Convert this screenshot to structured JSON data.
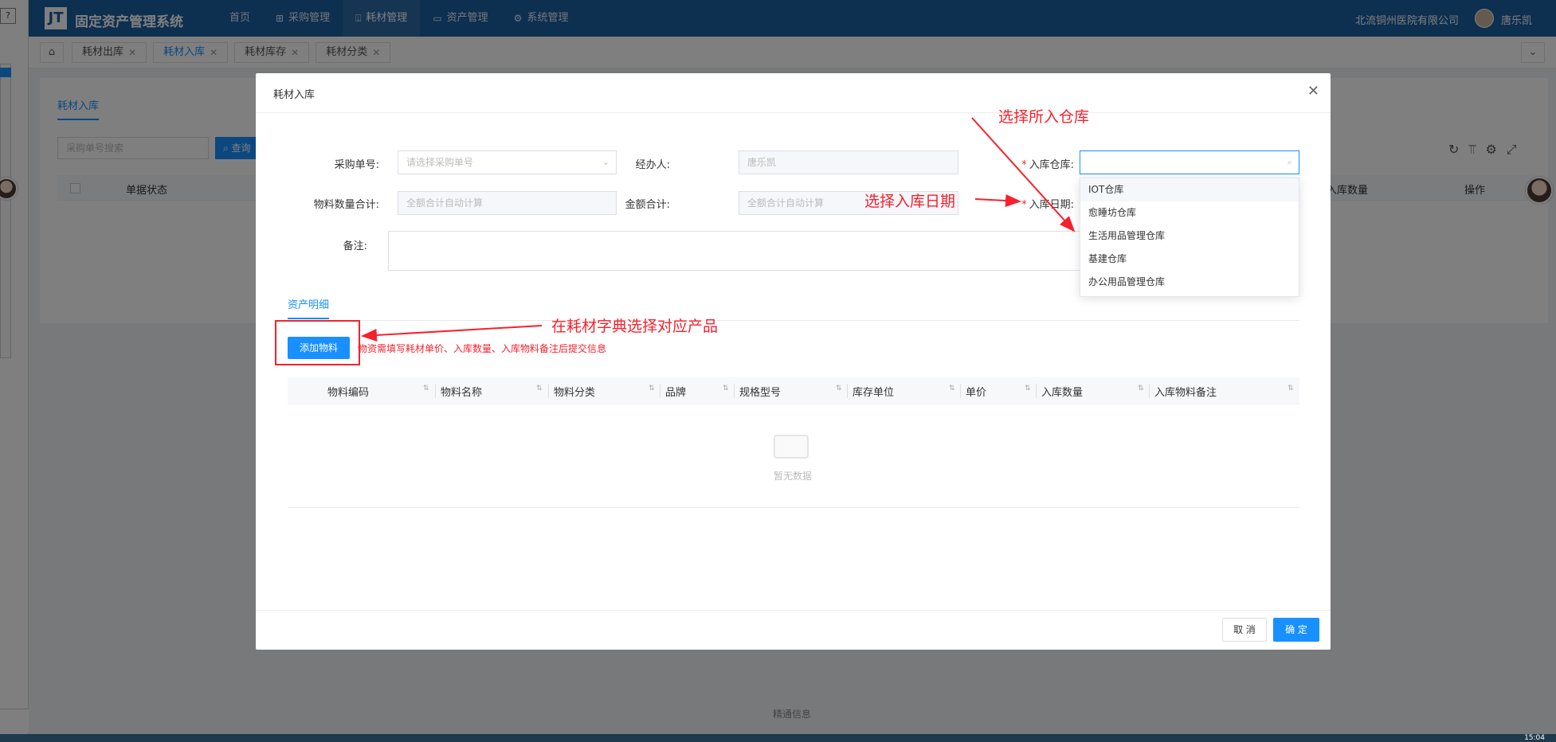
{
  "app": {
    "logo_text": "JT",
    "title": "固定资产管理系统",
    "nav": [
      {
        "label": "首页",
        "icon": ""
      },
      {
        "label": "采购管理",
        "icon": "grid-icon"
      },
      {
        "label": "耗材管理",
        "icon": "inbox-icon"
      },
      {
        "label": "资产管理",
        "icon": "calendar-icon"
      },
      {
        "label": "系统管理",
        "icon": "gear-icon"
      }
    ],
    "organization": "北流铜州医院有限公司",
    "user_name": "唐乐凯"
  },
  "tabs": [
    {
      "label": "耗材出库"
    },
    {
      "label": "耗材入库"
    },
    {
      "label": "耗材库存"
    },
    {
      "label": "耗材分类"
    }
  ],
  "background": {
    "section_tab": "耗材入库",
    "search_placeholder": "采购单号搜索",
    "query_label": "查询",
    "col_status": "单据状态",
    "col_quantity": "入库数量",
    "col_action": "操作",
    "footer": "精通信息",
    "clock": "15:04"
  },
  "modal": {
    "title": "耗材入库",
    "fields": {
      "purchase_no_label": "采购单号:",
      "purchase_no_placeholder": "请选择采购单号",
      "handler_label": "经办人:",
      "handler_value": "唐乐凯",
      "warehouse_label": "入库仓库:",
      "warehouse_value": "",
      "qty_total_label": "物料数量合计:",
      "qty_total_placeholder": "全额合计自动计算",
      "amount_total_label": "金额合计:",
      "amount_total_placeholder": "全额合计自动计算",
      "date_label": "入库日期:",
      "remark_label": "备注:"
    },
    "detail_tab": "资产明细",
    "add_button": "添加物料",
    "hint": "物资需填写耗材单价、入库数量、入库物料备注后提交信息",
    "columns": [
      "物料编码",
      "物料名称",
      "物料分类",
      "品牌",
      "规格型号",
      "库存单位",
      "单价",
      "入库数量",
      "入库物料备注"
    ],
    "empty_text": "暂无数据",
    "cancel_button": "取 消",
    "ok_button": "确 定"
  },
  "warehouse_options": [
    "IOT仓库",
    "愈睡坊仓库",
    "生活用品管理仓库",
    "基建仓库",
    "办公用品管理仓库"
  ],
  "annotations": {
    "select_warehouse": "选择所入仓库",
    "select_date": "选择入库日期",
    "select_product": "在耗材字典选择对应产品"
  },
  "colors": {
    "header_blue": "#1a5ea0",
    "primary": "#1890ff",
    "annotation_red": "#f5222d"
  }
}
